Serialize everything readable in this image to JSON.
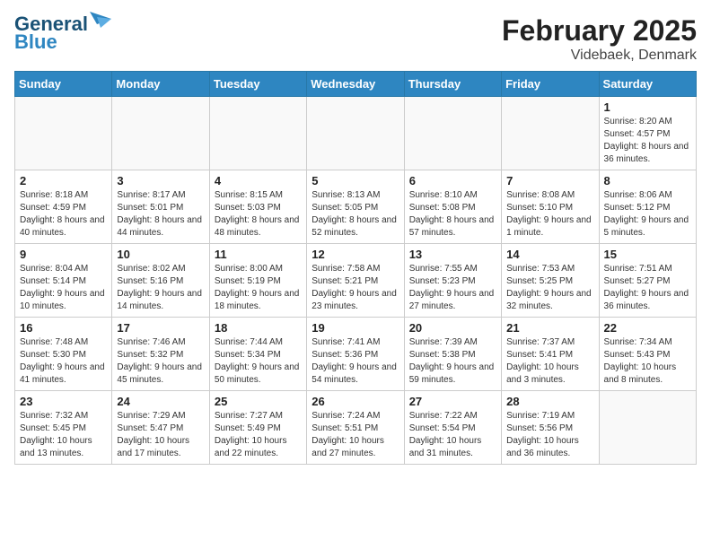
{
  "logo": {
    "line1": "General",
    "line2": "Blue"
  },
  "title": "February 2025",
  "subtitle": "Videbaek, Denmark",
  "days_of_week": [
    "Sunday",
    "Monday",
    "Tuesday",
    "Wednesday",
    "Thursday",
    "Friday",
    "Saturday"
  ],
  "weeks": [
    [
      {
        "day": "",
        "info": ""
      },
      {
        "day": "",
        "info": ""
      },
      {
        "day": "",
        "info": ""
      },
      {
        "day": "",
        "info": ""
      },
      {
        "day": "",
        "info": ""
      },
      {
        "day": "",
        "info": ""
      },
      {
        "day": "1",
        "info": "Sunrise: 8:20 AM\nSunset: 4:57 PM\nDaylight: 8 hours and 36 minutes."
      }
    ],
    [
      {
        "day": "2",
        "info": "Sunrise: 8:18 AM\nSunset: 4:59 PM\nDaylight: 8 hours and 40 minutes."
      },
      {
        "day": "3",
        "info": "Sunrise: 8:17 AM\nSunset: 5:01 PM\nDaylight: 8 hours and 44 minutes."
      },
      {
        "day": "4",
        "info": "Sunrise: 8:15 AM\nSunset: 5:03 PM\nDaylight: 8 hours and 48 minutes."
      },
      {
        "day": "5",
        "info": "Sunrise: 8:13 AM\nSunset: 5:05 PM\nDaylight: 8 hours and 52 minutes."
      },
      {
        "day": "6",
        "info": "Sunrise: 8:10 AM\nSunset: 5:08 PM\nDaylight: 8 hours and 57 minutes."
      },
      {
        "day": "7",
        "info": "Sunrise: 8:08 AM\nSunset: 5:10 PM\nDaylight: 9 hours and 1 minute."
      },
      {
        "day": "8",
        "info": "Sunrise: 8:06 AM\nSunset: 5:12 PM\nDaylight: 9 hours and 5 minutes."
      }
    ],
    [
      {
        "day": "9",
        "info": "Sunrise: 8:04 AM\nSunset: 5:14 PM\nDaylight: 9 hours and 10 minutes."
      },
      {
        "day": "10",
        "info": "Sunrise: 8:02 AM\nSunset: 5:16 PM\nDaylight: 9 hours and 14 minutes."
      },
      {
        "day": "11",
        "info": "Sunrise: 8:00 AM\nSunset: 5:19 PM\nDaylight: 9 hours and 18 minutes."
      },
      {
        "day": "12",
        "info": "Sunrise: 7:58 AM\nSunset: 5:21 PM\nDaylight: 9 hours and 23 minutes."
      },
      {
        "day": "13",
        "info": "Sunrise: 7:55 AM\nSunset: 5:23 PM\nDaylight: 9 hours and 27 minutes."
      },
      {
        "day": "14",
        "info": "Sunrise: 7:53 AM\nSunset: 5:25 PM\nDaylight: 9 hours and 32 minutes."
      },
      {
        "day": "15",
        "info": "Sunrise: 7:51 AM\nSunset: 5:27 PM\nDaylight: 9 hours and 36 minutes."
      }
    ],
    [
      {
        "day": "16",
        "info": "Sunrise: 7:48 AM\nSunset: 5:30 PM\nDaylight: 9 hours and 41 minutes."
      },
      {
        "day": "17",
        "info": "Sunrise: 7:46 AM\nSunset: 5:32 PM\nDaylight: 9 hours and 45 minutes."
      },
      {
        "day": "18",
        "info": "Sunrise: 7:44 AM\nSunset: 5:34 PM\nDaylight: 9 hours and 50 minutes."
      },
      {
        "day": "19",
        "info": "Sunrise: 7:41 AM\nSunset: 5:36 PM\nDaylight: 9 hours and 54 minutes."
      },
      {
        "day": "20",
        "info": "Sunrise: 7:39 AM\nSunset: 5:38 PM\nDaylight: 9 hours and 59 minutes."
      },
      {
        "day": "21",
        "info": "Sunrise: 7:37 AM\nSunset: 5:41 PM\nDaylight: 10 hours and 3 minutes."
      },
      {
        "day": "22",
        "info": "Sunrise: 7:34 AM\nSunset: 5:43 PM\nDaylight: 10 hours and 8 minutes."
      }
    ],
    [
      {
        "day": "23",
        "info": "Sunrise: 7:32 AM\nSunset: 5:45 PM\nDaylight: 10 hours and 13 minutes."
      },
      {
        "day": "24",
        "info": "Sunrise: 7:29 AM\nSunset: 5:47 PM\nDaylight: 10 hours and 17 minutes."
      },
      {
        "day": "25",
        "info": "Sunrise: 7:27 AM\nSunset: 5:49 PM\nDaylight: 10 hours and 22 minutes."
      },
      {
        "day": "26",
        "info": "Sunrise: 7:24 AM\nSunset: 5:51 PM\nDaylight: 10 hours and 27 minutes."
      },
      {
        "day": "27",
        "info": "Sunrise: 7:22 AM\nSunset: 5:54 PM\nDaylight: 10 hours and 31 minutes."
      },
      {
        "day": "28",
        "info": "Sunrise: 7:19 AM\nSunset: 5:56 PM\nDaylight: 10 hours and 36 minutes."
      },
      {
        "day": "",
        "info": ""
      }
    ]
  ]
}
